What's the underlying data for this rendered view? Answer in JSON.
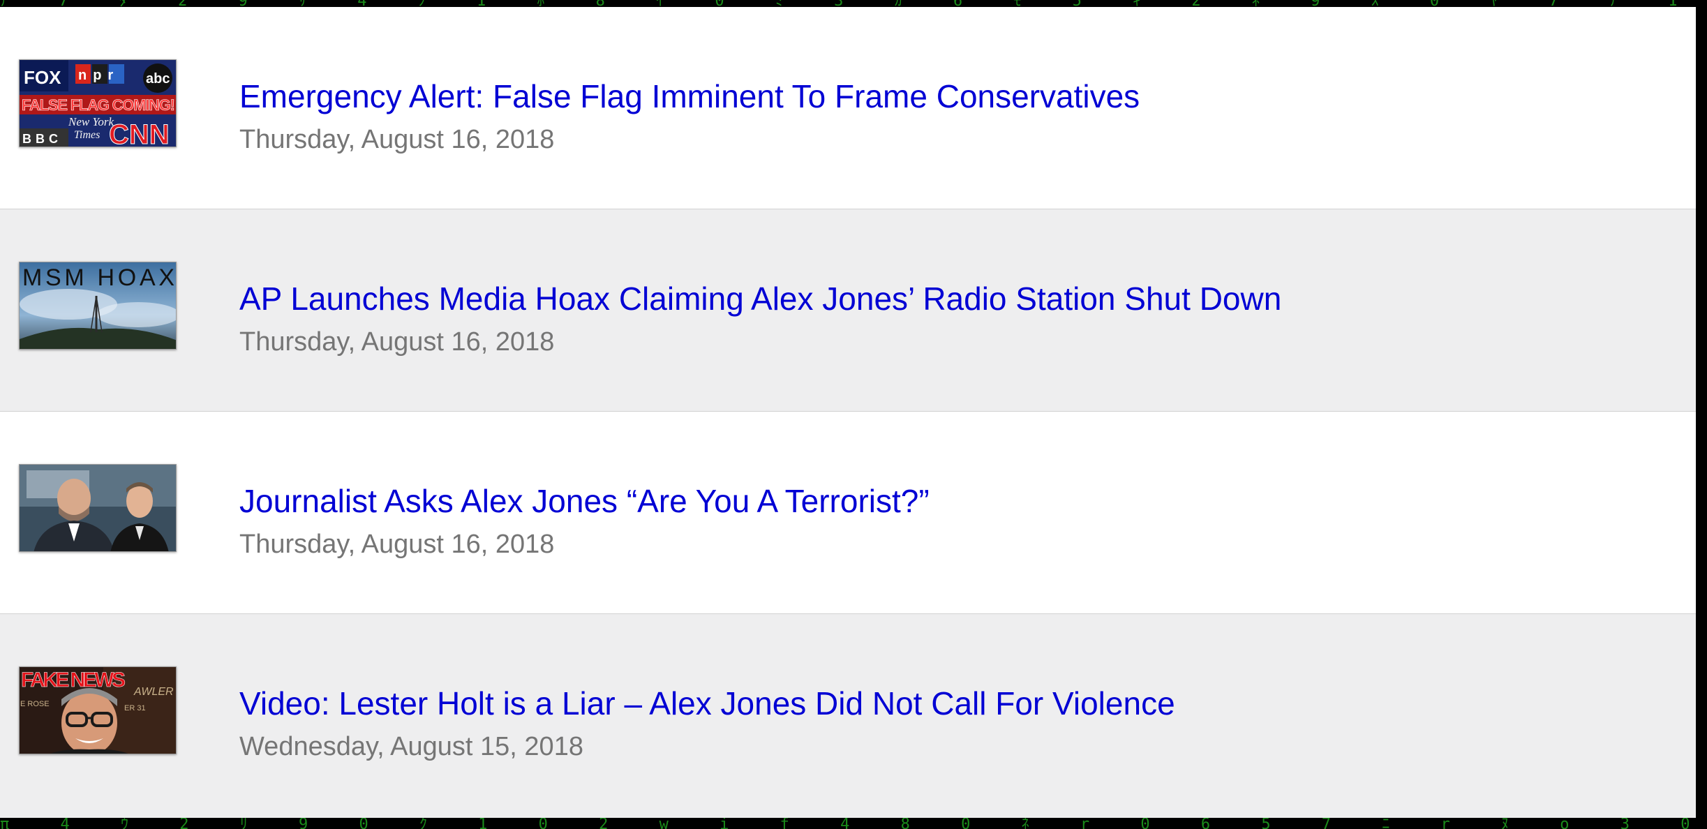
{
  "colors": {
    "link": "#0000d4",
    "date": "#757575",
    "row_alt_bg": "#eeeeef",
    "matrix_green": "#1fa31f"
  },
  "articles": [
    {
      "title": "Emergency Alert: False Flag Imminent To Frame Conservatives",
      "date": "Thursday, August 16, 2018",
      "thumbnail": {
        "texts": [
          "FOX",
          "npr",
          "abc",
          "FALSE FLAG COMING!",
          "New York",
          "Times",
          "BBC",
          "CNN"
        ]
      }
    },
    {
      "title": "AP Launches Media Hoax Claiming Alex Jones’ Radio Station Shut Down",
      "date": "Thursday, August 16, 2018",
      "thumbnail": {
        "texts": [
          "MSM HOAX"
        ]
      }
    },
    {
      "title": "Journalist Asks Alex Jones “Are You A Terrorist?”",
      "date": "Thursday, August 16, 2018",
      "thumbnail": {
        "texts": []
      }
    },
    {
      "title": "Video: Lester Holt is a Liar – Alex Jones Did Not Call For Violence",
      "date": "Wednesday, August 15, 2018",
      "thumbnail": {
        "texts": [
          "FAKE NEWS",
          "AWLER",
          "E ROSE",
          "ER 31"
        ]
      }
    }
  ]
}
